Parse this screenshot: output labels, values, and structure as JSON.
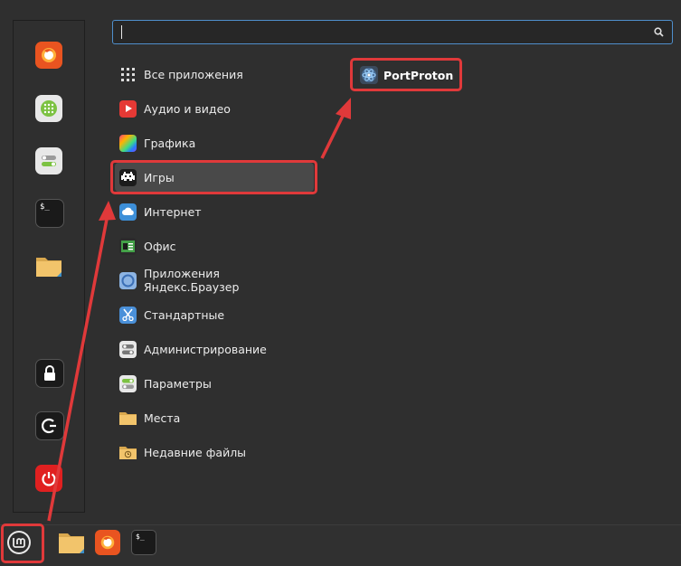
{
  "favorites": [
    {
      "icon": "firefox-icon",
      "color": "#e95420"
    },
    {
      "icon": "software-manager-icon",
      "color": "#e8e8e8"
    },
    {
      "icon": "system-settings-icon",
      "color": "#e8e8e8"
    },
    {
      "icon": "terminal-icon",
      "color": "#1a1a1a"
    },
    {
      "icon": "folder-icon",
      "color": "#f2c46b"
    },
    {
      "icon": "lock-screen-icon",
      "color": "#1a1a1a"
    },
    {
      "icon": "logout-icon",
      "color": "#1a1a1a"
    },
    {
      "icon": "power-off-icon",
      "color": "#e02020"
    }
  ],
  "search": {
    "value": "",
    "placeholder": ""
  },
  "categories": [
    {
      "label": "Все приложения",
      "icon": "grid-icon"
    },
    {
      "label": "Аудио и видео",
      "icon": "media-play-icon"
    },
    {
      "label": "Графика",
      "icon": "graphics-icon"
    },
    {
      "label": "Игры",
      "icon": "games-icon"
    },
    {
      "label": "Интернет",
      "icon": "cloud-icon"
    },
    {
      "label": "Офис",
      "icon": "office-icon"
    },
    {
      "label": "Приложения Яндекс.Браузер",
      "icon": "yandex-browser-icon"
    },
    {
      "label": "Стандартные",
      "icon": "scissors-icon"
    },
    {
      "label": "Администрирование",
      "icon": "admin-toggle-icon"
    },
    {
      "label": "Параметры",
      "icon": "settings-toggle-icon"
    },
    {
      "label": "Места",
      "icon": "folder-icon"
    },
    {
      "label": "Недавние файлы",
      "icon": "recent-folder-icon"
    }
  ],
  "selected_category": "Игры",
  "apps": [
    {
      "label": "PortProton",
      "icon": "portproton-icon"
    }
  ],
  "panel": [
    {
      "icon": "mint-menu-icon"
    },
    {
      "icon": "folder-icon"
    },
    {
      "icon": "firefox-icon"
    },
    {
      "icon": "terminal-icon"
    }
  ],
  "colors": {
    "highlight": "#e0393a",
    "background": "#2f2f2f",
    "accent": "#4f8fcc"
  }
}
